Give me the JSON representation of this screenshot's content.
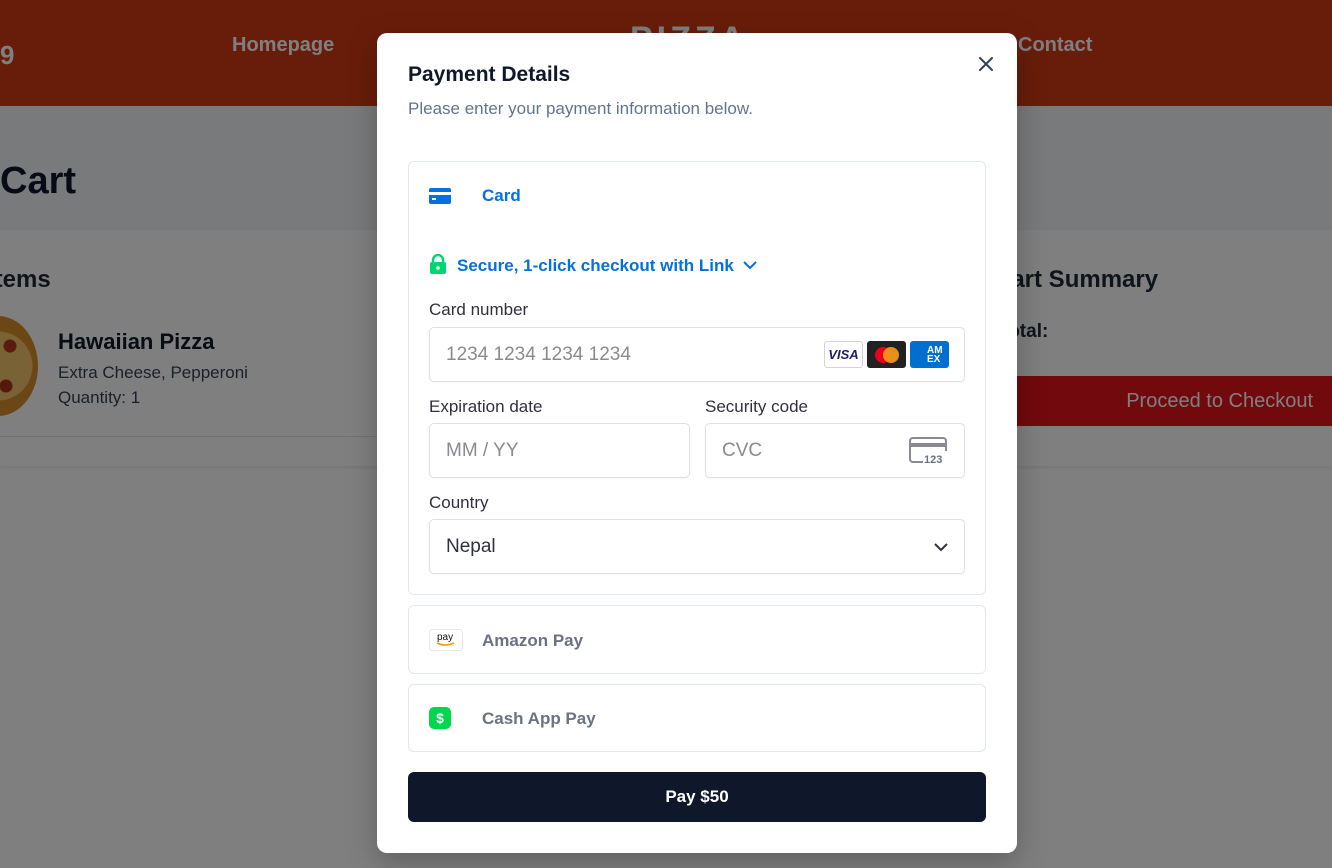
{
  "navbar": {
    "logo_fragment": "9",
    "brand_fragment": "PIZZA",
    "links": [
      "Homepage",
      "Contact"
    ]
  },
  "cart": {
    "title": "Cart",
    "items_title": "Items",
    "item": {
      "name": "Hawaiian Pizza",
      "extras": "Extra Cheese, Pepperoni",
      "quantity": "Quantity: 1"
    },
    "summary_title": "Cart Summary",
    "total_label": "Total:",
    "checkout_label": "Proceed to Checkout"
  },
  "modal": {
    "title": "Payment Details",
    "subtitle": "Please enter your payment information below.",
    "card_tab": "Card",
    "link_label": "Secure, 1-click checkout with Link",
    "card_number_label": "Card number",
    "card_number_placeholder": "1234 1234 1234 1234",
    "expiry_label": "Expiration date",
    "expiry_placeholder": "MM / YY",
    "cvc_label": "Security code",
    "cvc_placeholder": "CVC",
    "cvc_icon_text": "123",
    "country_label": "Country",
    "country_value": "Nepal",
    "brands": {
      "visa": "VISA",
      "amex": "AMEX"
    },
    "options": [
      {
        "label": "Amazon Pay",
        "icon_text": "pay"
      },
      {
        "label": "Cash App Pay",
        "icon_text": "$"
      }
    ],
    "pay_button": "Pay $50"
  },
  "colors": {
    "nav": "#d03a14",
    "link_blue": "#0570de",
    "checkout_red": "#e3131b",
    "pay_button": "#0f172a",
    "cashapp_green": "#00d64f",
    "lock_green": "#33ddb3"
  }
}
